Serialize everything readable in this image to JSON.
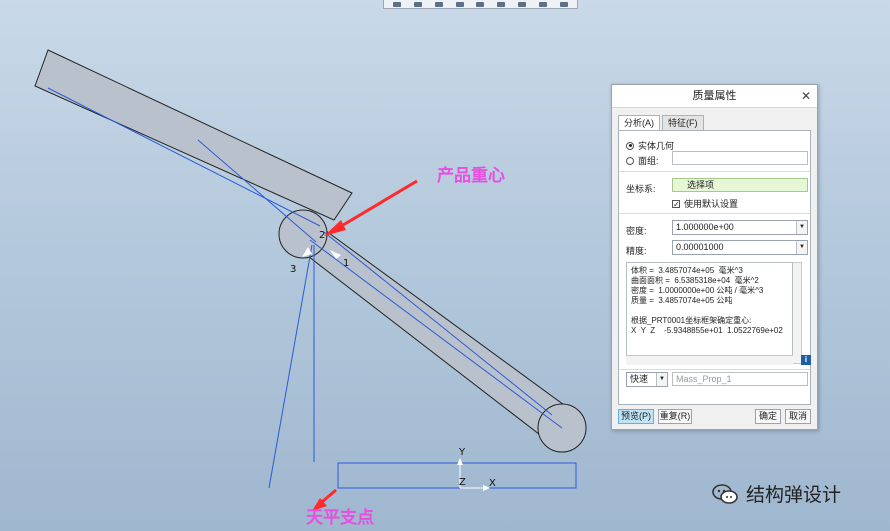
{
  "toolbar": {
    "icons": [
      "view-tool-icons"
    ]
  },
  "annotations": {
    "center_of_gravity": "产品重心",
    "balance_pivot": "天平支点"
  },
  "scene": {
    "labels": {
      "one": "1",
      "two": "2",
      "three": "3"
    },
    "axes": {
      "x": "X",
      "y": "Y",
      "z": "Z"
    }
  },
  "dialog": {
    "title": "质量属性",
    "tabs": [
      "分析(A)",
      "特征(F)"
    ],
    "solid_geometry": "实体几何",
    "quilt": "面组:",
    "coord_label": "坐标系:",
    "coord_value": "选择项",
    "use_default": "使用默认设置",
    "density_label": "密度:",
    "density_value": "1.000000e+00",
    "accuracy_label": "精度:",
    "accuracy_value": "0.00001000",
    "results_text": "体积 =  3.4857074e+05  毫米^3\n曲面面积 =  6.5385318e+04  毫米^2\n密度 =  1.0000000e+00 公吨 / 毫米^3\n质量 =  3.4857074e+05 公吨\n\n根据_PRT0001坐标框架确定重心:\nX  Y  Z    -5.9348855e+01  1.0522769e+02",
    "mode": "快速",
    "feature_name": "Mass_Prop_1",
    "preview": "预览(P)",
    "reset": "重复(R)",
    "ok": "确定",
    "cancel": "取消",
    "info": "i"
  },
  "watermark": {
    "text": "结构弹设计"
  },
  "colors": {
    "annotation": "#e64fe0",
    "arrow": "#ff2a2a",
    "model_fill": "#b9c2cc",
    "guide_line": "#2a5bd7"
  }
}
